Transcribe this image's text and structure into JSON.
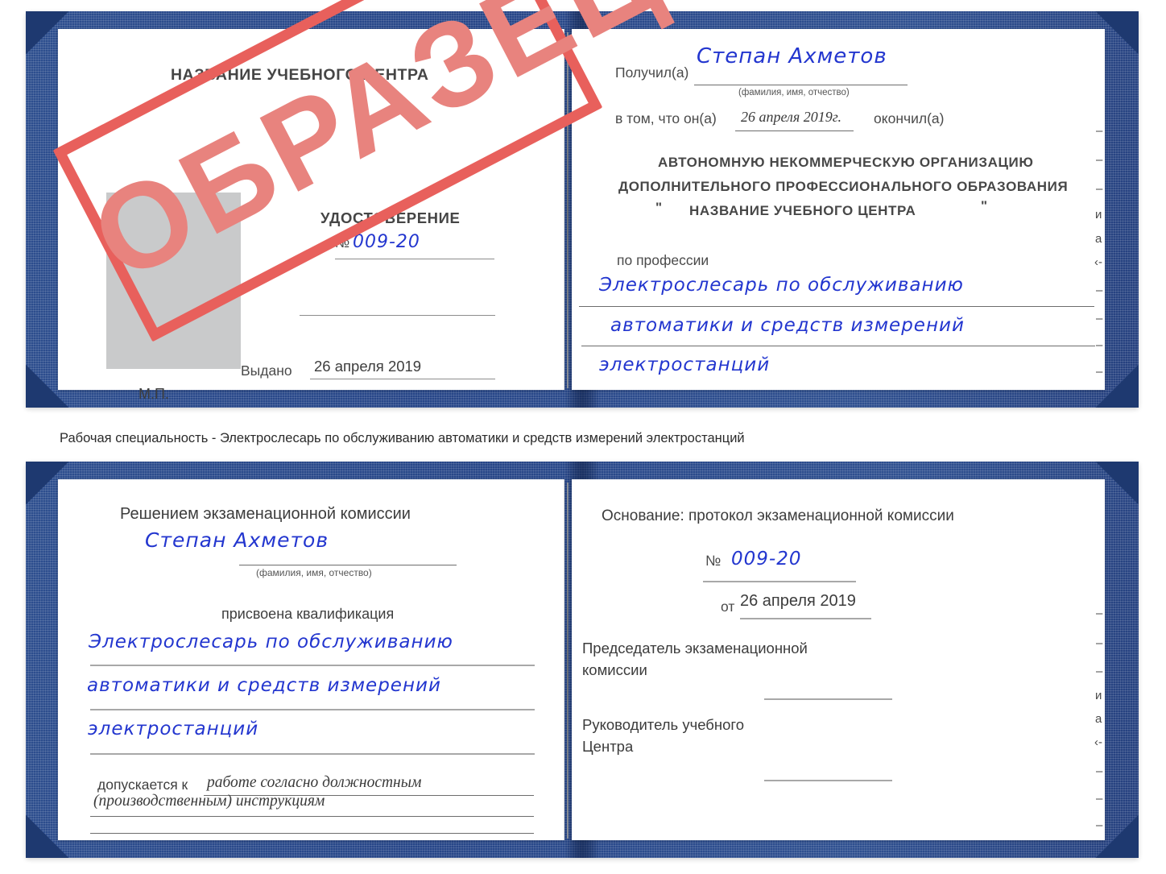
{
  "document": {
    "type": "certificate-scan",
    "colors": {
      "cover_blue": "#2d4e8e",
      "stamp_red": "#e8605c",
      "stamp_fill": "#e8837e",
      "handwriting_blue": "#2336cf",
      "photo_placeholder_gray": "#c9cacb",
      "rule_gray": "#8d8d8d"
    }
  },
  "stamp": {
    "text": "ОБРАЗЕЦ"
  },
  "booklet_top": {
    "left_page": {
      "center_title": "НАЗВАНИЕ УЧЕБНОГО ЦЕНТРА",
      "doc_word": "УДОСТОВЕРЕНИЕ",
      "number_symbol": "№",
      "number_value": "009-20",
      "issued_label": "Выдано",
      "issued_value": "26 апреля 2019",
      "seal_label": "М.П."
    },
    "right_page": {
      "received_label": "Получил(а)",
      "received_value": "Степан Ахметов",
      "fio_hint": "(фамилия, имя, отчество)",
      "in_that_label": "в том, что он(а)",
      "in_that_date": "26 апреля 2019г.",
      "finished_label": "окончил(а)",
      "org_line1": "АВТОНОМНУЮ НЕКОММЕРЧЕСКУЮ ОРГАНИЗАЦИЮ",
      "org_line2": "ДОПОЛНИТЕЛЬНОГО ПРОФЕССИОНАЛЬНОГО ОБРАЗОВАНИЯ",
      "org_quote_open": "\"",
      "org_line3": "НАЗВАНИЕ УЧЕБНОГО ЦЕНТРА",
      "org_quote_close": "\"",
      "profession_label": "по профессии",
      "profession_line1": "Электрослесарь по обслуживанию",
      "profession_line2": "автоматики и средств измерений",
      "profession_line3": "электростанций"
    },
    "edge_fragments": [
      "–",
      "–",
      "–",
      "–",
      "и",
      "а",
      "‹-",
      "–",
      "–",
      "–",
      "–"
    ]
  },
  "caption": {
    "text": "Рабочая специальность - Электрослесарь по обслуживанию автоматики и средств измерений электростанций"
  },
  "booklet_bottom": {
    "left_page": {
      "heading": "Решением экзаменационной комиссии",
      "name_value": "Степан Ахметов",
      "fio_hint": "(фамилия, имя, отчество)",
      "qualification_label": "присвоена квалификация",
      "qualification_line1": "Электрослесарь по обслуживанию",
      "qualification_line2": "автоматики и средств измерений",
      "qualification_line3": "электростанций",
      "admitted_label": "допускается к",
      "admitted_value_line1": "работе согласно должностным",
      "admitted_value_line2": "(производственным) инструкциям"
    },
    "right_page": {
      "basis_label": "Основание: протокол экзаменационной комиссии",
      "number_symbol": "№",
      "number_value": "009-20",
      "date_label": "от",
      "date_value": "26 апреля 2019",
      "chairman_line1": "Председатель экзаменационной",
      "chairman_line2": "комиссии",
      "head_line1": "Руководитель учебного",
      "head_line2": "Центра"
    },
    "edge_fragments": [
      "–",
      "–",
      "–",
      "и",
      "а",
      "‹-",
      "–",
      "–",
      "–",
      "–"
    ]
  }
}
